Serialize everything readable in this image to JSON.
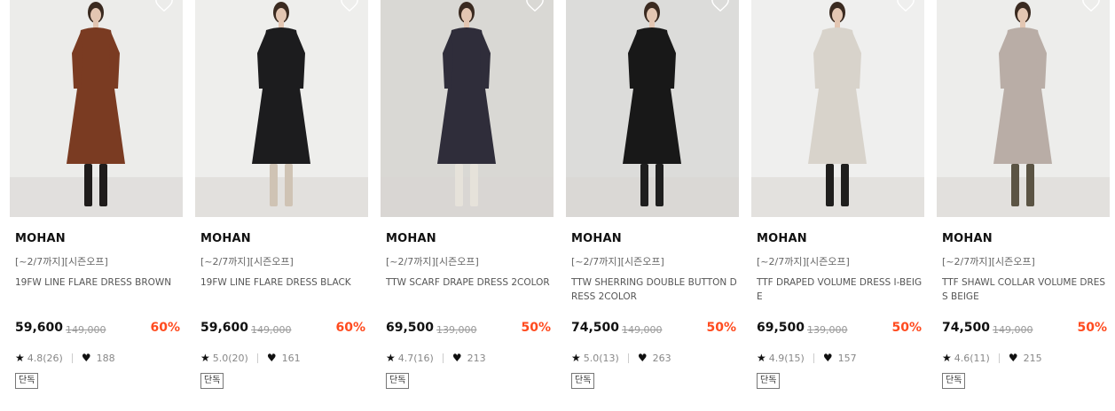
{
  "products": [
    {
      "brand": "MOHAN",
      "promo": "[~2/7까지][시즌오프]",
      "name": "19FW LINE FLARE DRESS BROWN",
      "price": "59,600",
      "original_price": "149,000",
      "discount": "60%",
      "rating": "4.8(26)",
      "likes": "188",
      "badge": "단독",
      "wall": "#ececea",
      "garment": "#7a3b22",
      "boots": "#1f1c1b",
      "icon": "heart-outline-icon"
    },
    {
      "brand": "MOHAN",
      "promo": "[~2/7까지][시즌오프]",
      "name": "19FW LINE FLARE DRESS BLACK",
      "price": "59,600",
      "original_price": "149,000",
      "discount": "60%",
      "rating": "5.0(20)",
      "likes": "161",
      "badge": "단독",
      "wall": "#eeeeec",
      "garment": "#1c1c1e",
      "boots": "#cfc3b4",
      "icon": "heart-outline-icon"
    },
    {
      "brand": "MOHAN",
      "promo": "[~2/7까지][시즌오프]",
      "name": "TTW SCARF DRAPE DRESS 2COLOR",
      "price": "69,500",
      "original_price": "139,000",
      "discount": "50%",
      "rating": "4.7(16)",
      "likes": "213",
      "badge": "단독",
      "wall": "#d9d8d4",
      "garment": "#2f2d3a",
      "boots": "#e6e2da",
      "icon": "heart-outline-icon"
    },
    {
      "brand": "MOHAN",
      "promo": "[~2/7까지][시즌오프]",
      "name": "TTW SHERRING DOUBLE BUTTON DRESS 2COLOR",
      "price": "74,500",
      "original_price": "149,000",
      "discount": "50%",
      "rating": "5.0(13)",
      "likes": "263",
      "badge": "단독",
      "wall": "#dcdcda",
      "garment": "#181818",
      "boots": "#1e1e1e",
      "icon": "heart-outline-icon"
    },
    {
      "brand": "MOHAN",
      "promo": "[~2/7까지][시즌오프]",
      "name": "TTF DRAPED VOLUME DRESS I-BEIGE",
      "price": "69,500",
      "original_price": "139,000",
      "discount": "50%",
      "rating": "4.9(15)",
      "likes": "157",
      "badge": "단독",
      "wall": "#efefee",
      "garment": "#d8d3cb",
      "boots": "#1f1e1d",
      "icon": "heart-outline-icon"
    },
    {
      "brand": "MOHAN",
      "promo": "[~2/7까지][시즌오프]",
      "name": "TTF SHAWL COLLAR VOLUME DRESS BEIGE",
      "price": "74,500",
      "original_price": "149,000",
      "discount": "50%",
      "rating": "4.6(11)",
      "likes": "215",
      "badge": "단독",
      "wall": "#ededeb",
      "garment": "#b9ada6",
      "boots": "#5b5444",
      "icon": "heart-outline-icon"
    }
  ]
}
